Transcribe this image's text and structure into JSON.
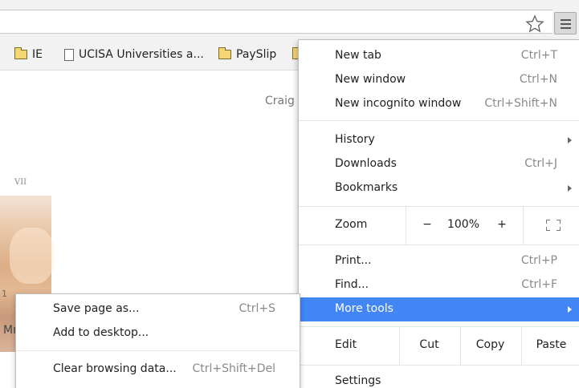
{
  "bookmarks": [
    {
      "label": "IE",
      "icon": "folder-icon"
    },
    {
      "label": "UCISA Universities a...",
      "icon": "page-icon"
    },
    {
      "label": "PaySlip",
      "icon": "folder-icon"
    }
  ],
  "page": {
    "craig_text": "Craig",
    "vii_text": "VII",
    "m_text": "Mr",
    "one_text": "1"
  },
  "menu": {
    "new_tab": {
      "label": "New tab",
      "shortcut": "Ctrl+T"
    },
    "new_window": {
      "label": "New window",
      "shortcut": "Ctrl+N"
    },
    "new_incognito": {
      "label": "New incognito window",
      "shortcut": "Ctrl+Shift+N"
    },
    "history": {
      "label": "History"
    },
    "downloads": {
      "label": "Downloads",
      "shortcut": "Ctrl+J"
    },
    "bookmarks": {
      "label": "Bookmarks"
    },
    "zoom": {
      "label": "Zoom",
      "minus": "−",
      "value": "100%",
      "plus": "+"
    },
    "print": {
      "label": "Print...",
      "shortcut": "Ctrl+P"
    },
    "find": {
      "label": "Find...",
      "shortcut": "Ctrl+F"
    },
    "more_tools": {
      "label": "More tools"
    },
    "edit": {
      "label": "Edit",
      "cut": "Cut",
      "copy": "Copy",
      "paste": "Paste"
    },
    "settings": {
      "label": "Settings"
    }
  },
  "submenu": {
    "save_page": {
      "label": "Save page as...",
      "shortcut": "Ctrl+S"
    },
    "add_desktop": {
      "label": "Add to desktop..."
    },
    "clear_data": {
      "label": "Clear browsing data...",
      "shortcut": "Ctrl+Shift+Del"
    }
  },
  "colors": {
    "highlight": "#4285f4",
    "toolbar": "#f2f2f2"
  }
}
